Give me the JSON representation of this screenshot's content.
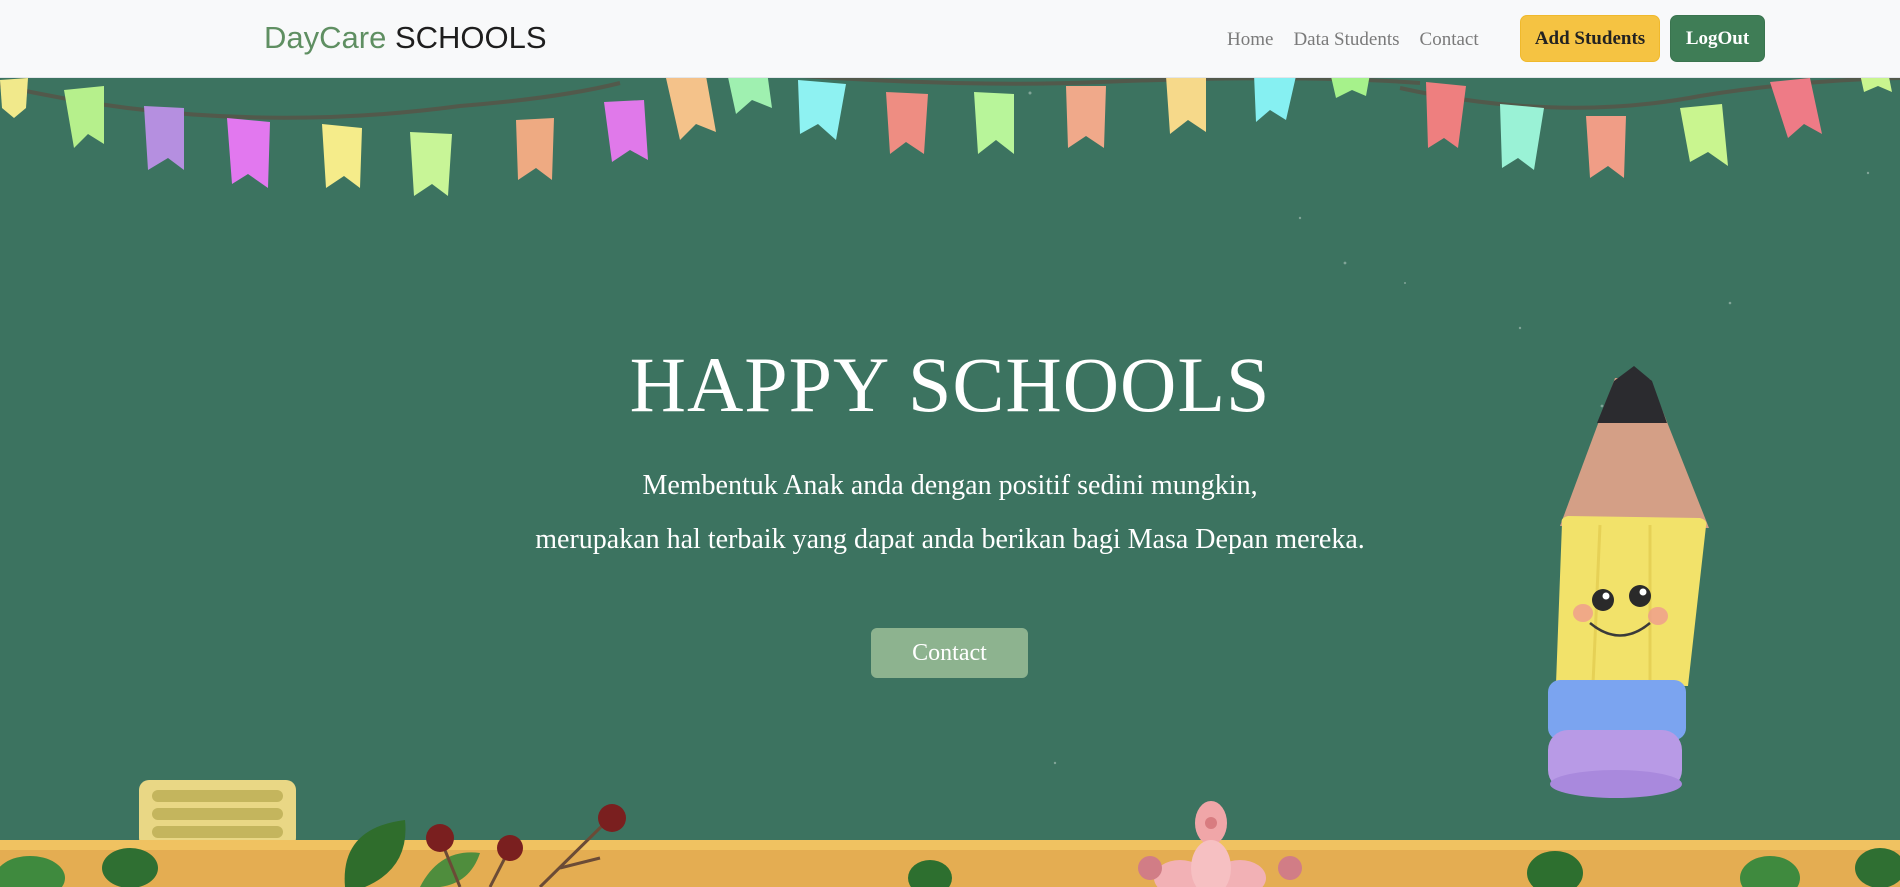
{
  "navbar": {
    "brand_accent": "DayCare",
    "brand_main": " SCHOOLS",
    "links": [
      "Home",
      "Data Students",
      "Contact"
    ],
    "add_button": "Add Students",
    "logout_button": "LogOut"
  },
  "hero": {
    "title": "HAPPY SCHOOLS",
    "line1": "Membentuk Anak anda dengan positif sedini mungkin,",
    "line2": "merupakan hal terbaik yang dapat anda berikan bagi Masa Depan mereka.",
    "contact_button": "Contact"
  },
  "colors": {
    "navbar_bg": "#f8f9fa",
    "brand_accent": "#5f8f62",
    "hero_bg": "#3c7360",
    "add_button_bg": "#f5c342",
    "logout_button_bg": "#3f7d56",
    "contact_button_bg": "#8db38f"
  },
  "decorations": {
    "flag_colors": [
      "#f1e98b",
      "#b6f08c",
      "#b58fe0",
      "#e278ef",
      "#f5ec8a",
      "#c8f597",
      "#eeaa82",
      "#e079ea",
      "#f4c28a",
      "#9ff0b0",
      "#8ef2f2",
      "#ee8d82",
      "#b8f59a",
      "#f0a98a",
      "#f6d98a",
      "#86f0f2",
      "#a6f28b",
      "#ee7f7f",
      "#9af2d6",
      "#f09d86",
      "#c9f58f",
      "#ee7b86"
    ],
    "illustrations": [
      "bunting-flags",
      "pencil-character",
      "desk-plants",
      "chalkboard-eraser",
      "flower"
    ]
  }
}
